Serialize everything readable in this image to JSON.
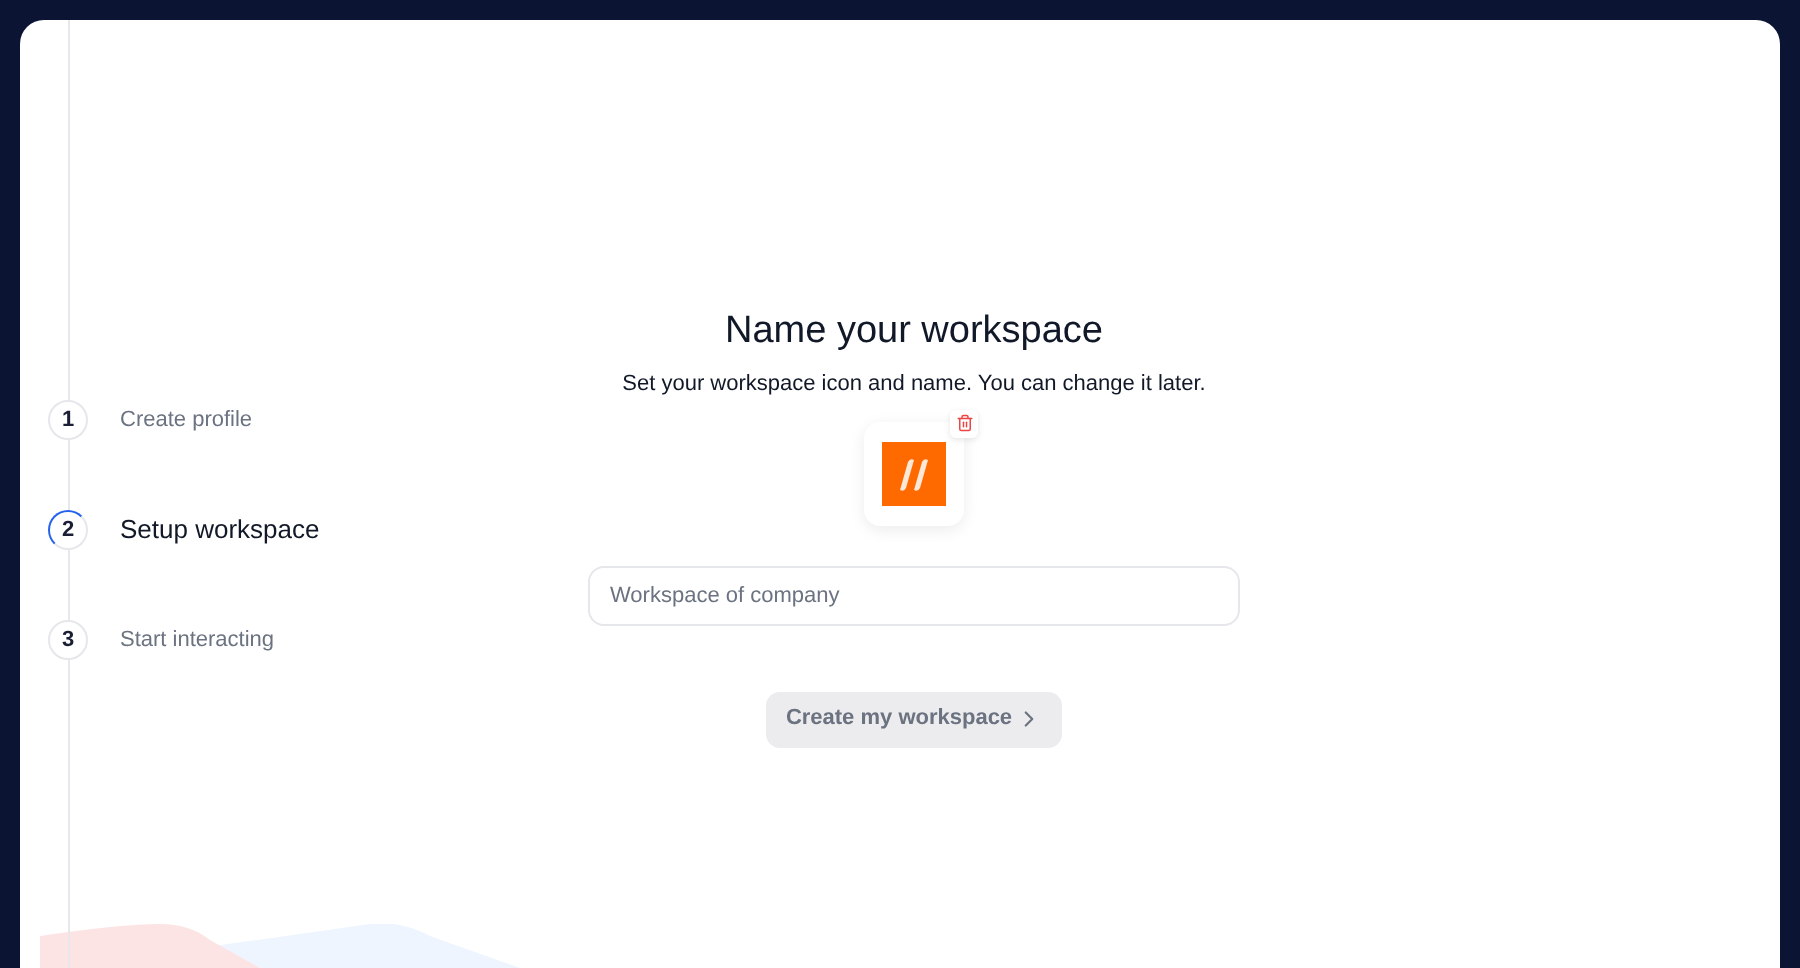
{
  "steps": [
    {
      "number": "1",
      "label": "Create profile",
      "selected": false
    },
    {
      "number": "2",
      "label": "Setup workspace",
      "selected": true
    },
    {
      "number": "3",
      "label": "Start interacting",
      "selected": false
    }
  ],
  "heading": "Name your workspace",
  "subtitle": "Set your workspace icon and name. You can change it later.",
  "name_field": {
    "placeholder": "Workspace of company"
  },
  "submit_button": {
    "label": "Create my workspace",
    "disabled": true
  }
}
